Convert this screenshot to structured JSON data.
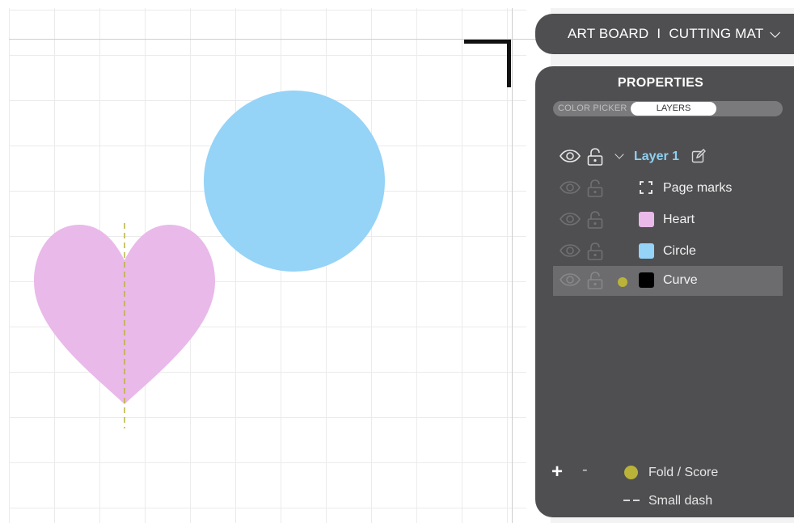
{
  "header": {
    "artboard_label": "ART BOARD",
    "separator": "I",
    "mat_label": "CUTTING MAT",
    "chevron_icon": "chevron-down-icon"
  },
  "panel": {
    "title": "PROPERTIES",
    "tabs": [
      {
        "label": "COLOR PICKER",
        "active": false
      },
      {
        "label": "LAYERS",
        "active": true
      }
    ],
    "group": {
      "name": "Layer 1",
      "color": "#8fd0ef",
      "icon": "edit-icon"
    },
    "layers": [
      {
        "name": "Page marks",
        "icon": "page-marks-icon"
      },
      {
        "name": "Heart",
        "color": "#e9b9ea"
      },
      {
        "name": "Circle",
        "color": "#95d3f7"
      },
      {
        "name": "Curve",
        "color": "#000000",
        "selected": true,
        "marker_color": "#b9b33a"
      }
    ],
    "add_label": "+",
    "remove_label": "-",
    "legend": {
      "fold_label": "Fold / Score",
      "fold_color": "#b9b33a",
      "dash_label": "Small dash"
    }
  },
  "canvas": {
    "heart_color": "#e9b9ea",
    "circle_color": "#95d3f7",
    "fold_line_color": "#b9b33a"
  }
}
